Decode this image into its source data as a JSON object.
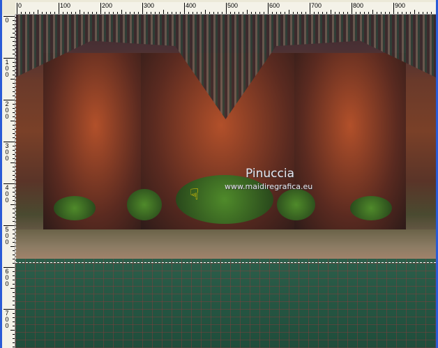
{
  "rulers": {
    "horizontal_labels": [
      "0",
      "100",
      "200",
      "300",
      "400",
      "500",
      "600",
      "700",
      "800",
      "900"
    ],
    "vertical_labels": [
      "0",
      "100",
      "200",
      "300",
      "400",
      "500",
      "600",
      "700"
    ]
  },
  "watermark": {
    "name": "Pinuccia",
    "url": "www.maidiregrafica.eu"
  },
  "icons": {
    "cursor": "pointing-hand-cursor-icon"
  },
  "colors": {
    "floor": "#24513f",
    "ruler": "#f4f2e8",
    "window_border": "#2a5bd7"
  }
}
